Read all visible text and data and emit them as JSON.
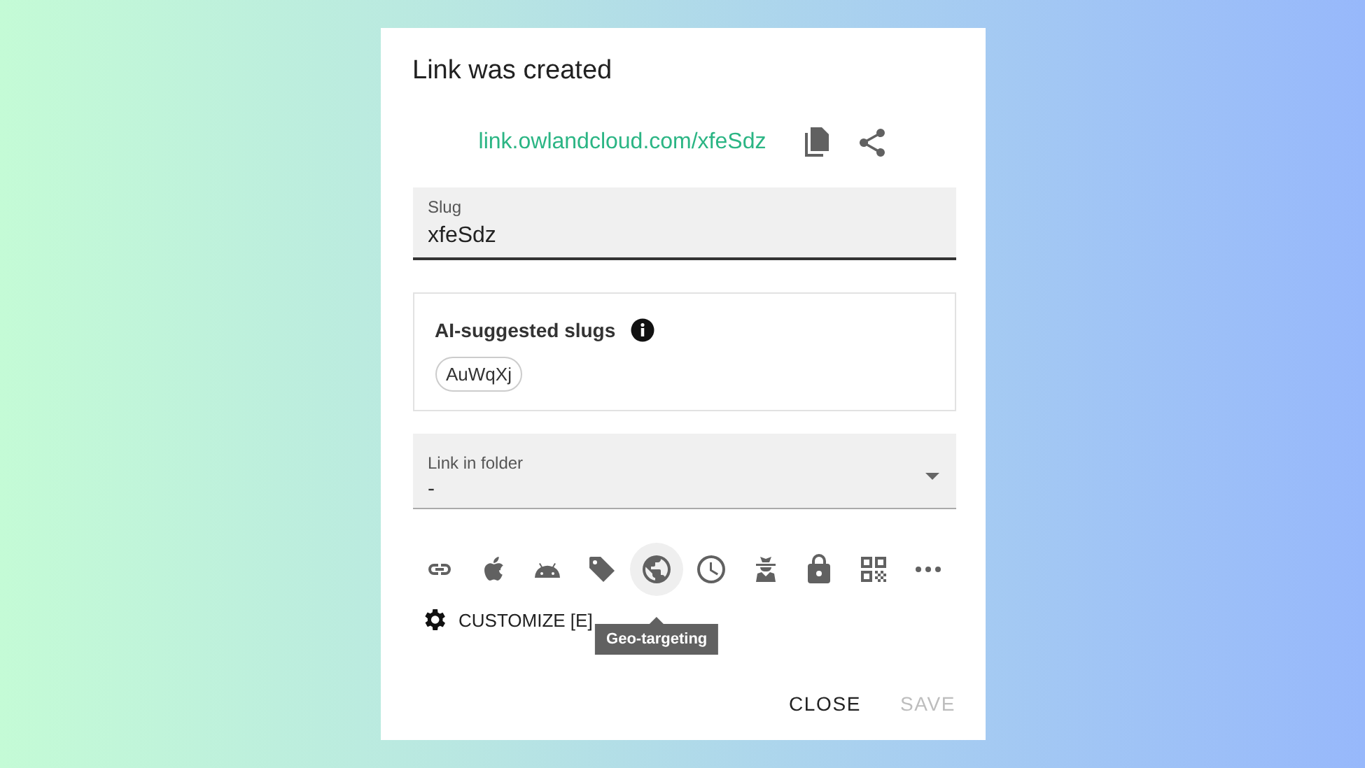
{
  "dialog": {
    "title": "Link was created",
    "short_link": "link.owlandcloud.com/xfeSdz"
  },
  "slug_field": {
    "label": "Slug",
    "value": "xfeSdz"
  },
  "suggestions": {
    "title": "AI-suggested slugs",
    "chips": [
      "AuWqXj"
    ]
  },
  "folder_select": {
    "label": "Link in folder",
    "value": "-"
  },
  "toolbar": [
    {
      "kind": "link",
      "selected": false
    },
    {
      "kind": "apple",
      "selected": false
    },
    {
      "kind": "android",
      "selected": false
    },
    {
      "kind": "tag",
      "selected": false
    },
    {
      "kind": "globe",
      "selected": true
    },
    {
      "kind": "clock",
      "selected": false
    },
    {
      "kind": "spy",
      "selected": false
    },
    {
      "kind": "lock",
      "selected": false
    },
    {
      "kind": "qr",
      "selected": false
    },
    {
      "kind": "more",
      "selected": false
    }
  ],
  "tooltip": "Geo-targeting",
  "customize": {
    "label": "CUSTOMIZE [E]"
  },
  "buttons": [
    {
      "label": "CLOSE",
      "disabled": false
    },
    {
      "label": "SAVE",
      "disabled": true
    }
  ]
}
